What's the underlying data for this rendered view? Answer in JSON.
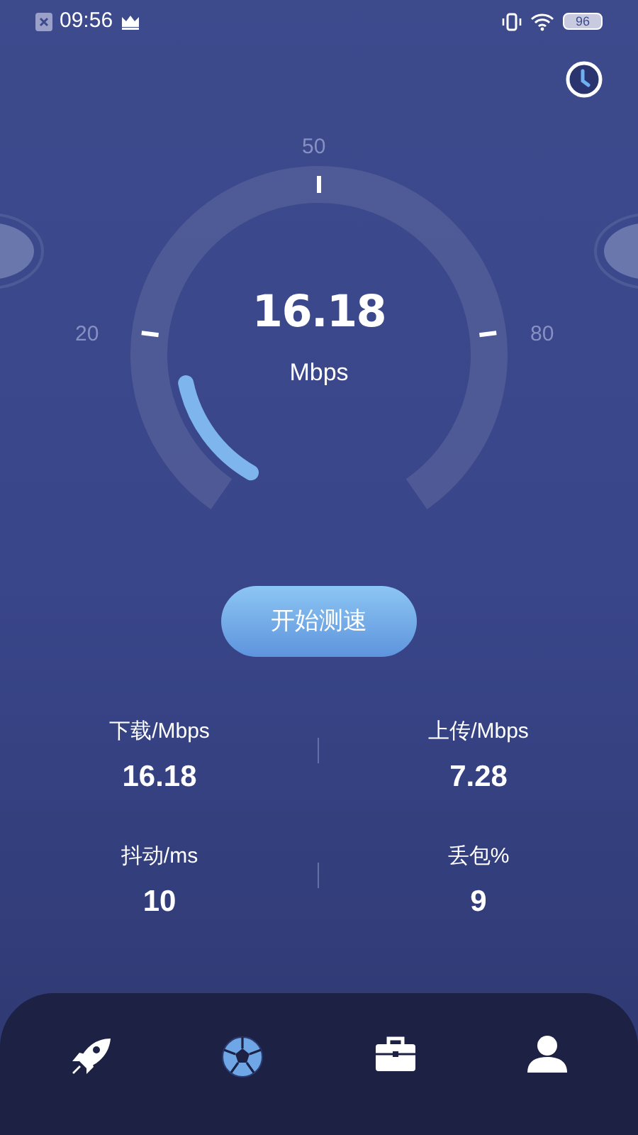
{
  "status_bar": {
    "time": "09:56",
    "battery": "96"
  },
  "gauge": {
    "ticks": [
      {
        "label": "20"
      },
      {
        "label": "50"
      },
      {
        "label": "80"
      }
    ],
    "value": "16.18",
    "unit": "Mbps",
    "level": 0.16
  },
  "start_button": {
    "label": "开始测速"
  },
  "stats": [
    {
      "label": "下载/Mbps",
      "value": "16.18"
    },
    {
      "label": "上传/Mbps",
      "value": "7.28"
    },
    {
      "label": "抖动/ms",
      "value": "10"
    },
    {
      "label": "丢包%",
      "value": "9"
    }
  ],
  "bottom_nav": [
    {
      "kind": "rocket",
      "selected": false
    },
    {
      "kind": "ball",
      "selected": true
    },
    {
      "kind": "briefcase",
      "selected": false
    },
    {
      "kind": "person",
      "selected": false
    }
  ]
}
